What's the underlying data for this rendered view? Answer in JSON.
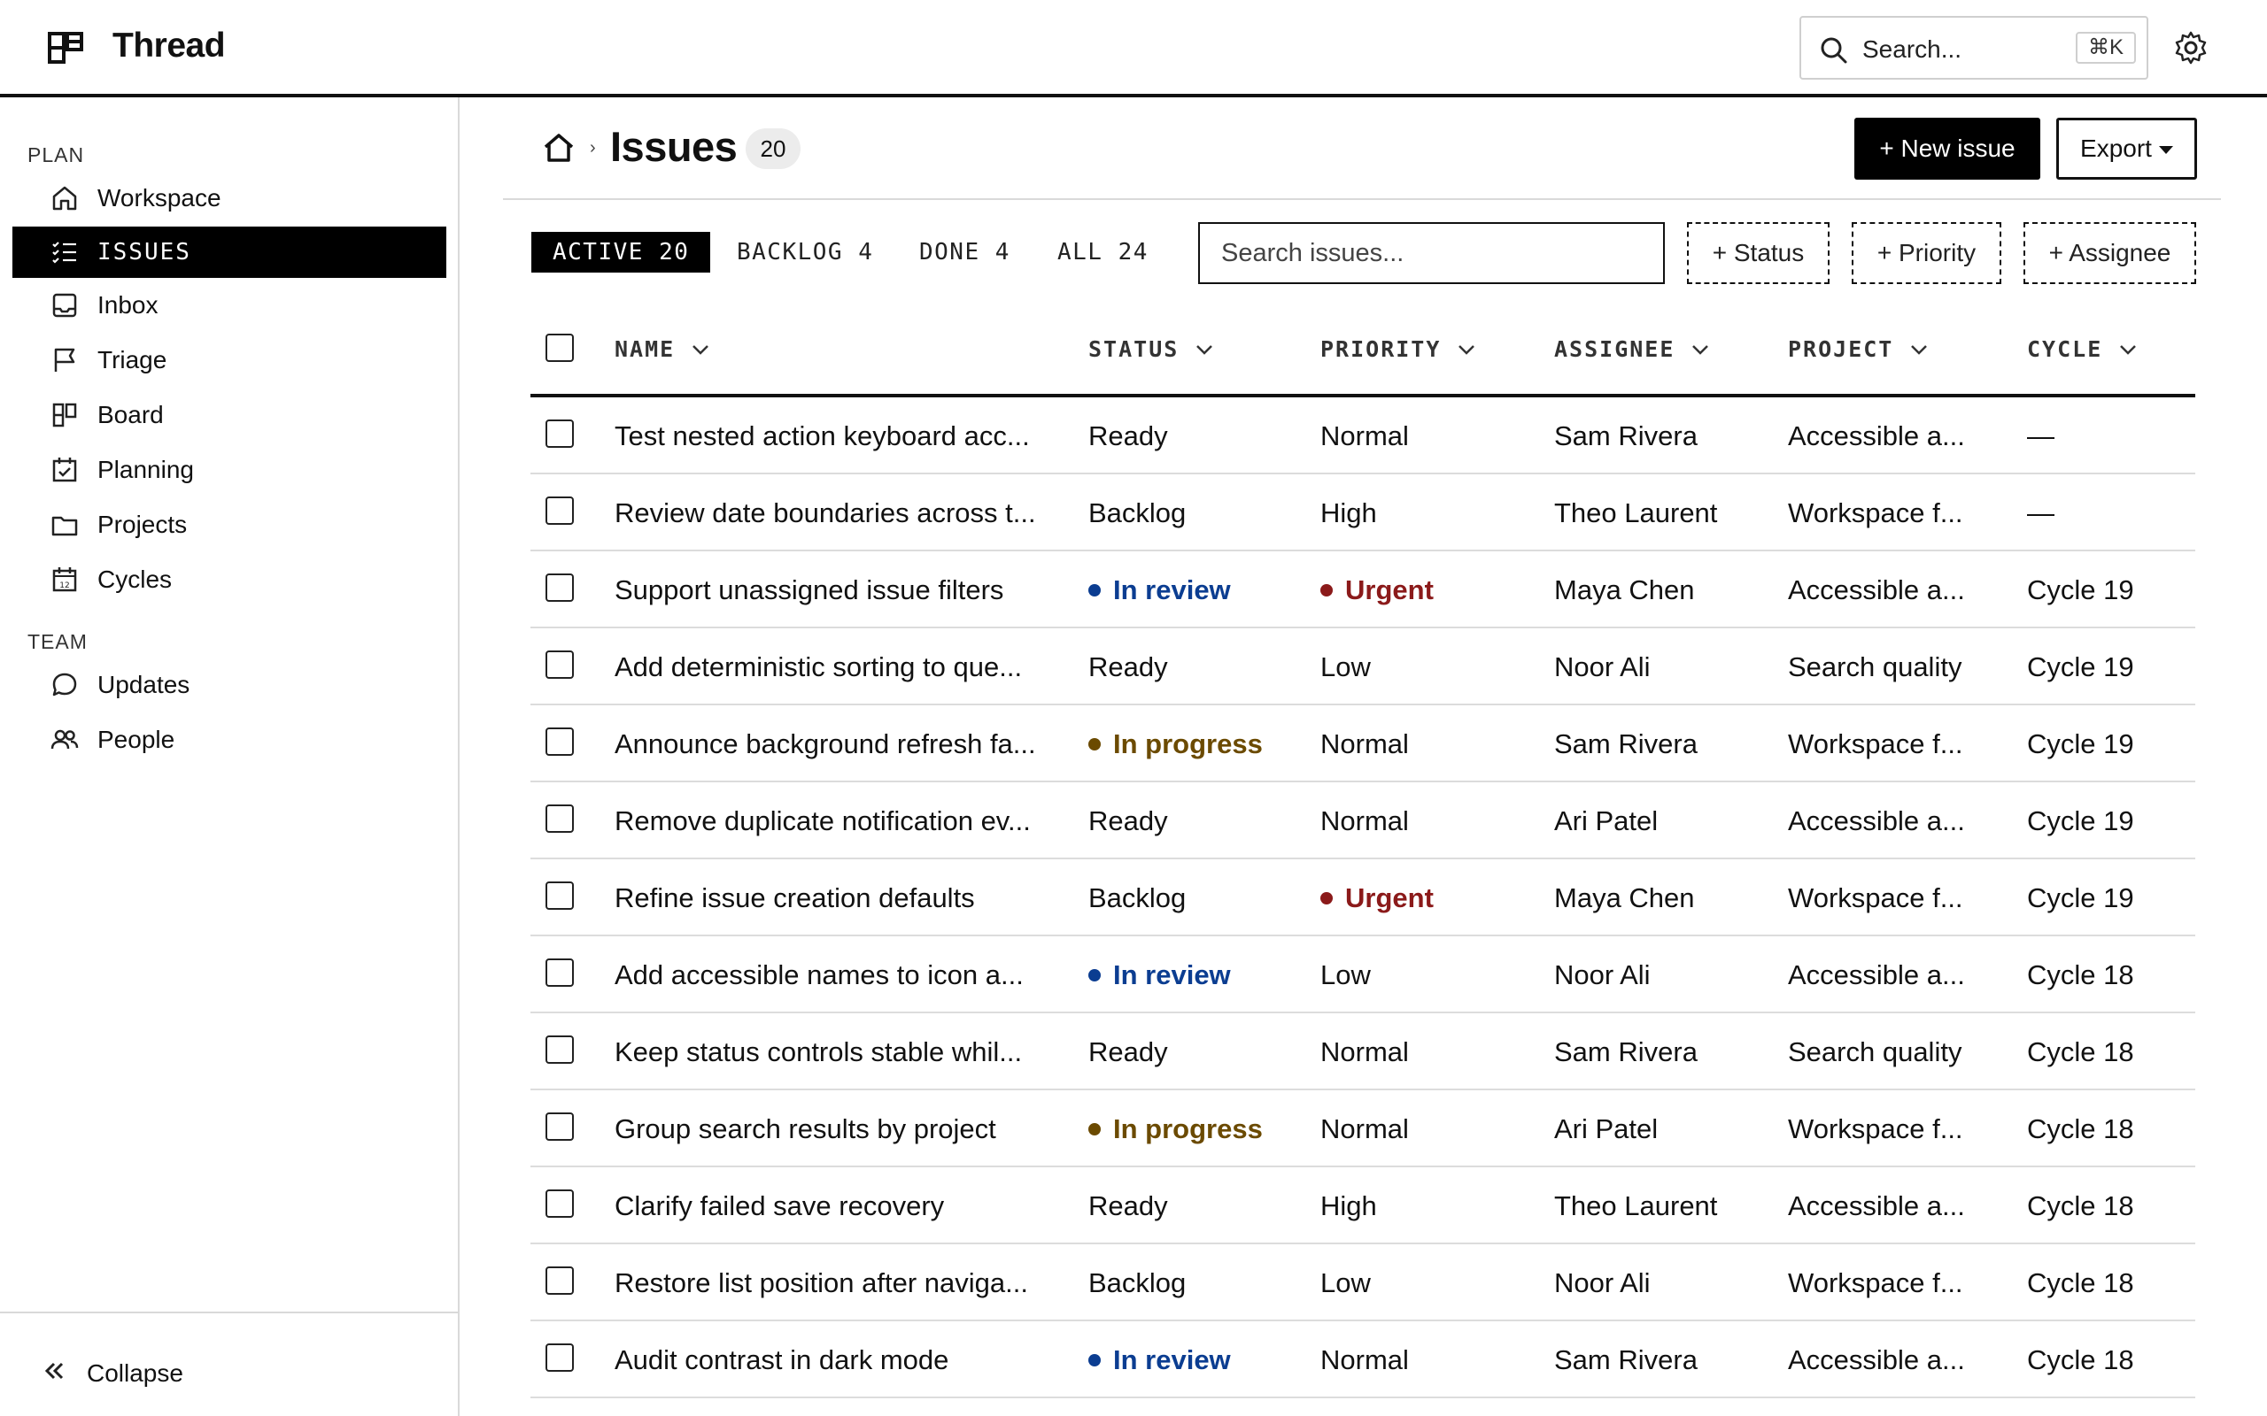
{
  "app": {
    "title": "Thread"
  },
  "search": {
    "placeholder": "Search...",
    "shortcut": "⌘K"
  },
  "sidebar": {
    "plan_label": "PLAN",
    "team_label": "TEAM",
    "items": [
      {
        "label": "Workspace",
        "icon": "home-icon"
      },
      {
        "label": "ISSUES",
        "icon": "list-check-icon",
        "active": true
      },
      {
        "label": "Inbox",
        "icon": "inbox-icon"
      },
      {
        "label": "Triage",
        "icon": "flag-icon"
      },
      {
        "label": "Board",
        "icon": "board-icon"
      },
      {
        "label": "Planning",
        "icon": "calendar-check-icon"
      },
      {
        "label": "Projects",
        "icon": "folder-icon"
      },
      {
        "label": "Cycles",
        "icon": "calendar-icon"
      }
    ],
    "team_items": [
      {
        "label": "Updates",
        "icon": "chat-bubble-icon"
      },
      {
        "label": "People",
        "icon": "people-icon"
      }
    ],
    "collapse_label": "Collapse"
  },
  "header": {
    "separator": "›",
    "title": "Issues",
    "count": "20",
    "new_issue_label": "+ New issue",
    "export_label": "Export"
  },
  "tabs": [
    {
      "label": "ACTIVE 20",
      "active": true
    },
    {
      "label": "BACKLOG 4"
    },
    {
      "label": "DONE 4"
    },
    {
      "label": "ALL 24"
    }
  ],
  "filters": {
    "search_placeholder": "Search issues...",
    "chips": [
      "+ Status",
      "+ Priority",
      "+ Assignee"
    ]
  },
  "columns": [
    "NAME",
    "STATUS",
    "PRIORITY",
    "ASSIGNEE",
    "PROJECT",
    "CYCLE"
  ],
  "rows": [
    {
      "name": "Test nested action keyboard acc...",
      "status": "Ready",
      "priority": "Normal",
      "assignee": "Sam Rivera",
      "project": "Accessible a...",
      "cycle": "—"
    },
    {
      "name": "Review date boundaries across t...",
      "status": "Backlog",
      "priority": "High",
      "assignee": "Theo Laurent",
      "project": "Workspace f...",
      "cycle": "—"
    },
    {
      "name": "Support unassigned issue filters",
      "status": "In review",
      "priority": "Urgent",
      "assignee": "Maya Chen",
      "project": "Accessible a...",
      "cycle": "Cycle 19"
    },
    {
      "name": "Add deterministic sorting to que...",
      "status": "Ready",
      "priority": "Low",
      "assignee": "Noor Ali",
      "project": "Search quality",
      "cycle": "Cycle 19"
    },
    {
      "name": "Announce background refresh fa...",
      "status": "In progress",
      "priority": "Normal",
      "assignee": "Sam Rivera",
      "project": "Workspace f...",
      "cycle": "Cycle 19"
    },
    {
      "name": "Remove duplicate notification ev...",
      "status": "Ready",
      "priority": "Normal",
      "assignee": "Ari Patel",
      "project": "Accessible a...",
      "cycle": "Cycle 19"
    },
    {
      "name": "Refine issue creation defaults",
      "status": "Backlog",
      "priority": "Urgent",
      "assignee": "Maya Chen",
      "project": "Workspace f...",
      "cycle": "Cycle 19"
    },
    {
      "name": "Add accessible names to icon a...",
      "status": "In review",
      "priority": "Low",
      "assignee": "Noor Ali",
      "project": "Accessible a...",
      "cycle": "Cycle 18"
    },
    {
      "name": "Keep status controls stable whil...",
      "status": "Ready",
      "priority": "Normal",
      "assignee": "Sam Rivera",
      "project": "Search quality",
      "cycle": "Cycle 18"
    },
    {
      "name": "Group search results by project",
      "status": "In progress",
      "priority": "Normal",
      "assignee": "Ari Patel",
      "project": "Workspace f...",
      "cycle": "Cycle 18"
    },
    {
      "name": "Clarify failed save recovery",
      "status": "Ready",
      "priority": "High",
      "assignee": "Theo Laurent",
      "project": "Accessible a...",
      "cycle": "Cycle 18"
    },
    {
      "name": "Restore list position after naviga...",
      "status": "Backlog",
      "priority": "Low",
      "assignee": "Noor Ali",
      "project": "Workspace f...",
      "cycle": "Cycle 18"
    },
    {
      "name": "Audit contrast in dark mode",
      "status": "In review",
      "priority": "Normal",
      "assignee": "Sam Rivera",
      "project": "Accessible a...",
      "cycle": "Cycle 18"
    }
  ],
  "colors": {
    "in_review": "#0b3d91",
    "in_progress": "#6b4a00",
    "urgent": "#8b1a1a",
    "accent": "#000000"
  }
}
